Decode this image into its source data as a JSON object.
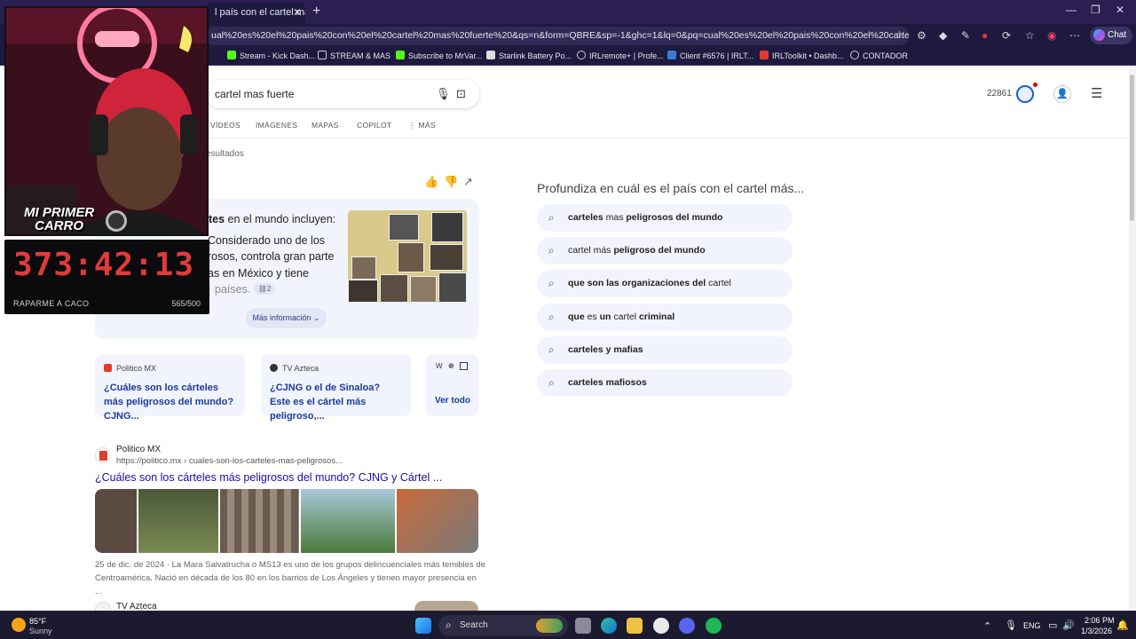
{
  "browser": {
    "tab_title": "l país con el cartel mas fu",
    "url": "ual%20es%20el%20pais%20con%20el%20cartel%20mas%20fuerte%20&qs=n&form=QBRE&sp=-1&ghc=1&lq=0&pq=cual%20es%20el%20pais%20con%20el%20cartel%20mas%20fu...",
    "chat_label": "Chat",
    "bookmarks": [
      "Stream - Kick Dash...",
      "STREAM & MAS",
      "Subscribe to MrVar...",
      "Starlink Battery Po...",
      "IRLremote+ | Profe...",
      "Client #6576 | IRLT...",
      "IRLToolkit • Dashb...",
      "CONTADOR"
    ]
  },
  "search": {
    "query": "cartel mas fuerte",
    "tabs": [
      "VÍDEOS",
      "IMÁGENES",
      "MAPAS",
      "COPILOT",
      "MÁS"
    ],
    "points": "22861",
    "results_label": "esultados"
  },
  "ai_answer": {
    "line1_bold": "tes",
    "line1_rest": " en el mundo incluyen:",
    "line2": "Considerado uno de los",
    "line3": "rosos, controla gran parte",
    "line4": "as en México y tiene",
    "line5": "países.",
    "cite_count": "2",
    "more_label": "Más información"
  },
  "source_cards": [
    {
      "site": "Politico MX",
      "title": "¿Cuáles son los cárteles más peligrosos del mundo? CJNG..."
    },
    {
      "site": "TV Azteca",
      "title": "¿CJNG o el de Sinaloa? Este es el cártel más peligroso,..."
    }
  ],
  "see_all": "Ver todo",
  "result": {
    "site": "Politico MX",
    "url": "https://politico.mx › cuales-son-los-carteles-mas-peligrosos...",
    "title": "¿Cuáles son los cárteles más peligrosos del mundo? CJNG y Cártel ...",
    "snippet1": "25 de dic. de 2024 · La Mara Salvatrucha o MS13 es uno de los grupos delincuenciales más temibles de",
    "snippet2": "Centroamérica. Nació en década de los 80 en los barrios de Los Ángeles y tienen mayor presencia en ..."
  },
  "result3_site": "TV Azteca",
  "related": {
    "heading": "Profundiza en cuál es el país con el cartel más...",
    "items": [
      [
        {
          "t": "carteles",
          "b": true
        },
        {
          "t": " mas ",
          "b": false
        },
        {
          "t": "peligrosos del mundo",
          "b": true
        }
      ],
      [
        {
          "t": "cartel más ",
          "b": false
        },
        {
          "t": "peligroso del mundo",
          "b": true
        }
      ],
      [
        {
          "t": "que son las organizaciones del",
          "b": true
        },
        {
          "t": " cartel",
          "b": false
        }
      ],
      [
        {
          "t": "que",
          "b": true
        },
        {
          "t": " es ",
          "b": false
        },
        {
          "t": "un",
          "b": true
        },
        {
          "t": " cartel ",
          "b": false
        },
        {
          "t": "criminal",
          "b": true
        }
      ],
      [
        {
          "t": "carteles y mafias",
          "b": true
        }
      ],
      [
        {
          "t": "carteles mafiosos",
          "b": true
        }
      ]
    ]
  },
  "overlay": {
    "cam_text1": "MI PRIMER",
    "cam_text2": "CARRO",
    "timer": "373:42:13",
    "timer_label": "RAPARME A CACO",
    "timer_count": "565/500"
  },
  "taskbar": {
    "temp": "85°F",
    "weather": "Sunny",
    "search_label": "Search",
    "lang": "ENG",
    "time": "2:06 PM",
    "date": "1/3/2026"
  }
}
